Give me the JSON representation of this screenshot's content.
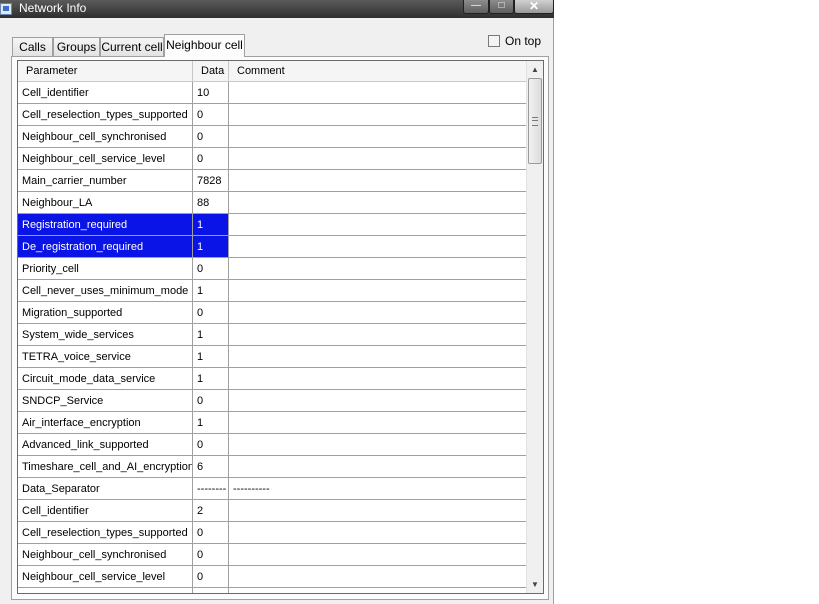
{
  "window": {
    "title": "Network Info"
  },
  "title_buttons": {
    "minimize": "—",
    "maximize": "□",
    "close": "✕"
  },
  "tabs": [
    {
      "label": "Calls",
      "active": false
    },
    {
      "label": "Groups",
      "active": false
    },
    {
      "label": "Current cell",
      "active": false
    },
    {
      "label": "Neighbour cell",
      "active": true
    }
  ],
  "on_top": {
    "label": "On top",
    "checked": false
  },
  "table": {
    "columns": [
      "Parameter",
      "Data",
      "Comment"
    ],
    "rows": [
      {
        "parameter": "Cell_identifier",
        "data": "10",
        "comment": "",
        "selected": false
      },
      {
        "parameter": "Cell_reselection_types_supported",
        "data": "0",
        "comment": "",
        "selected": false
      },
      {
        "parameter": "Neighbour_cell_synchronised",
        "data": "0",
        "comment": "",
        "selected": false
      },
      {
        "parameter": "Neighbour_cell_service_level",
        "data": "0",
        "comment": "",
        "selected": false
      },
      {
        "parameter": "Main_carrier_number",
        "data": "7828",
        "comment": "",
        "selected": false
      },
      {
        "parameter": "Neighbour_LA",
        "data": "88",
        "comment": "",
        "selected": false
      },
      {
        "parameter": "Registration_required",
        "data": "1",
        "comment": "",
        "selected": true
      },
      {
        "parameter": "De_registration_required",
        "data": "1",
        "comment": "",
        "selected": true
      },
      {
        "parameter": "Priority_cell",
        "data": "0",
        "comment": "",
        "selected": false
      },
      {
        "parameter": "Cell_never_uses_minimum_mode",
        "data": "1",
        "comment": "",
        "selected": false
      },
      {
        "parameter": "Migration_supported",
        "data": "0",
        "comment": "",
        "selected": false
      },
      {
        "parameter": "System_wide_services",
        "data": "1",
        "comment": "",
        "selected": false
      },
      {
        "parameter": "TETRA_voice_service",
        "data": "1",
        "comment": "",
        "selected": false
      },
      {
        "parameter": "Circuit_mode_data_service",
        "data": "1",
        "comment": "",
        "selected": false
      },
      {
        "parameter": "SNDCP_Service",
        "data": "0",
        "comment": "",
        "selected": false
      },
      {
        "parameter": "Air_interface_encryption",
        "data": "1",
        "comment": "",
        "selected": false
      },
      {
        "parameter": "Advanced_link_supported",
        "data": "0",
        "comment": "",
        "selected": false
      },
      {
        "parameter": "Timeshare_cell_and_AI_encryption",
        "data": "6",
        "comment": "",
        "selected": false
      },
      {
        "parameter": "Data_Separator",
        "data": "--------",
        "comment": "----------",
        "selected": false
      },
      {
        "parameter": "Cell_identifier",
        "data": "2",
        "comment": "",
        "selected": false
      },
      {
        "parameter": "Cell_reselection_types_supported",
        "data": "0",
        "comment": "",
        "selected": false
      },
      {
        "parameter": "Neighbour_cell_synchronised",
        "data": "0",
        "comment": "",
        "selected": false
      },
      {
        "parameter": "Neighbour_cell_service_level",
        "data": "0",
        "comment": "",
        "selected": false
      },
      {
        "parameter": "",
        "data": "",
        "comment": "",
        "selected": false
      }
    ]
  },
  "scrollbar": {
    "up": "▲",
    "down": "▼"
  },
  "colors": {
    "selection": "#0a14e6",
    "titlebar": "#2e2e2e",
    "window_bg": "#f0f0f0"
  }
}
